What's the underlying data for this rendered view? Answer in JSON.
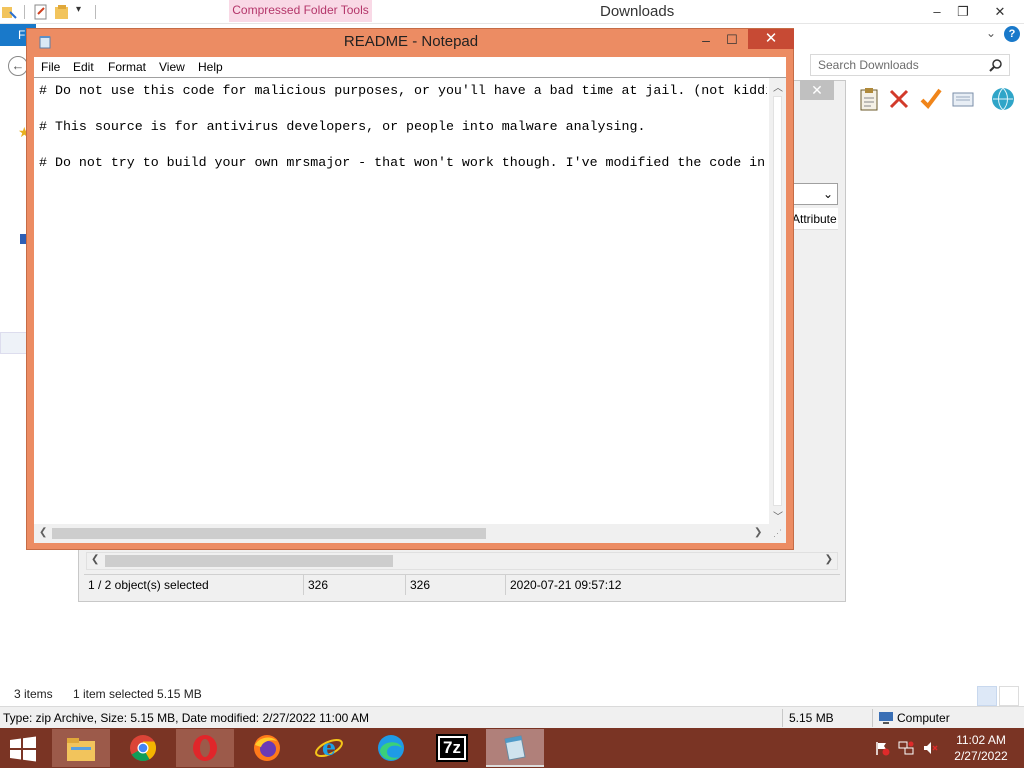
{
  "explorer": {
    "title": "Downloads",
    "contextual_tab": "Compressed Folder Tools",
    "file_tab": "F",
    "window_controls": {
      "minimize": "–",
      "restore": "❐",
      "close": "✕"
    },
    "ribbon_expand": "⌄",
    "help": "?",
    "search_placeholder": "Search Downloads",
    "status": {
      "items": "3 items",
      "selected": "1 item selected  5.15 MB"
    },
    "details_bar": {
      "info": "Type: zip Archive, Size: 5.15 MB, Date modified: 2/27/2022 11:00 AM",
      "size": "5.15 MB",
      "location": "Computer"
    }
  },
  "sevenzip": {
    "close": "✕",
    "column_attributes": "Attribute",
    "combo_arrow": "⌄",
    "status": {
      "selected": "1 / 2 object(s) selected",
      "size": "326",
      "packed": "326",
      "modified": "2020-07-21 09:57:12"
    }
  },
  "notepad": {
    "title": "README - Notepad",
    "controls": {
      "minimize": "–",
      "maximize": "☐",
      "close": "✕"
    },
    "menu": [
      "File",
      "Edit",
      "Format",
      "View",
      "Help"
    ],
    "lines": [
      "# Do not use this code for malicious purposes, or you'll have a bad time at jail. (not kidding)",
      "",
      "# This source is for antivirus developers, or people into malware analysing.",
      "",
      "# Do not try to build your own mrsmajor - that won't work though. I've modified the code in many places"
    ]
  },
  "taskbar": {
    "apps": [
      "file-explorer",
      "chrome",
      "opera",
      "firefox",
      "internet-explorer",
      "edge",
      "7-zip",
      "notepad"
    ],
    "seven_zip_label": "7z",
    "clock": {
      "time": "11:02 AM",
      "date": "2/27/2022"
    }
  },
  "colors": {
    "notepad_frame": "#ec8c63",
    "notepad_close": "#c74a34",
    "taskbar": "#7a3424",
    "explorer_accent": "#1979ca",
    "context_tab": "#f9d9e6"
  }
}
